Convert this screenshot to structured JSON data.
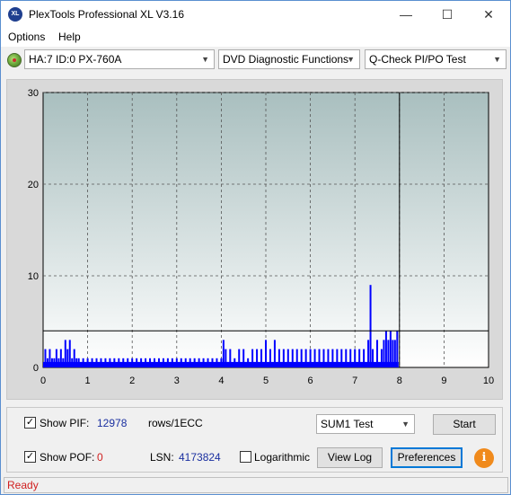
{
  "window": {
    "title": "PlexTools Professional XL V3.16",
    "app_icon_text": "XL",
    "minimize_glyph": "—",
    "maximize_glyph": "☐",
    "close_glyph": "✕"
  },
  "menu": {
    "items": [
      {
        "label": "Options",
        "mnemonic": "O"
      },
      {
        "label": "Help",
        "mnemonic": "H"
      }
    ]
  },
  "toolbar": {
    "drive_select": "HA:7 ID:0  PX-760A",
    "function_select": "DVD Diagnostic Functions",
    "test_select": "Q-Check PI/PO Test",
    "dropdown_glyph": "⌄"
  },
  "chart_data": {
    "type": "bar",
    "x_ticks": [
      "0",
      "1",
      "2",
      "3",
      "4",
      "5",
      "6",
      "7",
      "8",
      "9",
      "10"
    ],
    "y_ticks": [
      "0",
      "10",
      "20",
      "30"
    ],
    "xlim": [
      0,
      10
    ],
    "ylim": [
      0,
      30
    ],
    "grid": true,
    "threshold_line_y": 4,
    "marker_line_x": 8,
    "series": [
      {
        "color": "#0000ff",
        "x": [
          0.05,
          0.1,
          0.15,
          0.2,
          0.25,
          0.3,
          0.35,
          0.4,
          0.45,
          0.5,
          0.55,
          0.6,
          0.65,
          0.7,
          0.75,
          0.8,
          0.9,
          1.0,
          1.1,
          1.2,
          1.3,
          1.4,
          1.5,
          1.6,
          1.7,
          1.8,
          1.9,
          2.0,
          2.1,
          2.2,
          2.3,
          2.4,
          2.5,
          2.6,
          2.7,
          2.8,
          2.9,
          3.0,
          3.1,
          3.2,
          3.3,
          3.4,
          3.5,
          3.6,
          3.7,
          3.8,
          3.9,
          4.0,
          4.05,
          4.1,
          4.2,
          4.3,
          4.4,
          4.5,
          4.6,
          4.7,
          4.8,
          4.9,
          5.0,
          5.1,
          5.2,
          5.3,
          5.4,
          5.5,
          5.6,
          5.7,
          5.8,
          5.9,
          6.0,
          6.1,
          6.2,
          6.3,
          6.4,
          6.5,
          6.6,
          6.7,
          6.8,
          6.9,
          7.0,
          7.1,
          7.2,
          7.3,
          7.35,
          7.4,
          7.5,
          7.6,
          7.65,
          7.7,
          7.75,
          7.8,
          7.85,
          7.9,
          7.95
        ],
        "values": [
          2,
          1,
          2,
          1,
          1,
          2,
          1,
          2,
          1,
          3,
          2,
          3,
          1,
          2,
          1,
          1,
          1,
          1,
          1,
          1,
          1,
          1,
          1,
          1,
          1,
          1,
          1,
          1,
          1,
          1,
          1,
          1,
          1,
          1,
          1,
          1,
          1,
          1,
          1,
          1,
          1,
          1,
          1,
          1,
          1,
          1,
          1,
          1,
          3,
          2,
          2,
          1,
          2,
          2,
          1,
          2,
          2,
          2,
          3,
          2,
          3,
          2,
          2,
          2,
          2,
          2,
          2,
          2,
          2,
          2,
          2,
          2,
          2,
          2,
          2,
          2,
          2,
          2,
          2,
          2,
          2,
          3,
          9,
          2,
          3,
          2,
          3,
          4,
          3,
          4,
          3,
          3,
          4
        ]
      },
      {
        "color": "#00bcbc",
        "x": [
          0.3,
          0.6,
          1.4,
          2.6,
          3.3
        ],
        "values": [
          0.4,
          0.4,
          0.3,
          0.3,
          0.3
        ]
      }
    ]
  },
  "controls": {
    "show_pif_label": "Show PIF:",
    "show_pif_checked": "✓",
    "pif_value": "12978",
    "pif_unit": "rows/1ECC",
    "show_pof_label": "Show POF:",
    "show_pof_checked": "✓",
    "pof_value": "0",
    "lsn_label": "LSN:",
    "lsn_value": "4173824",
    "logarithmic_label": "Logarithmic",
    "test_mode_select": "SUM1 Test",
    "start_label": "Start",
    "view_log_label": "View Log",
    "preferences_label": "Preferences",
    "info_glyph": "i"
  },
  "status": {
    "text": "Ready"
  }
}
